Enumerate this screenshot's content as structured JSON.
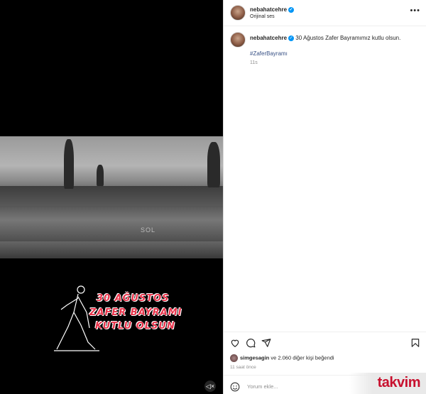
{
  "media": {
    "banner_lines": [
      "30 AĞUSTOS",
      "ZAFER BAYRAMI",
      "KUTLU OLSUN"
    ],
    "watermark": "SOL"
  },
  "header": {
    "username": "nebahatcehre",
    "subtitle": "Orijinal ses"
  },
  "caption": {
    "username": "nebahatcehre",
    "text": "30 Ağustos Zafer Bayramımız kutlu olsun.",
    "hashtag": "#ZaferBayramı",
    "time": "11s"
  },
  "likes": {
    "first_user": "simgesagin",
    "rest": "ve 2.060 diğer kişi beğendi"
  },
  "post_time": "11 saat önce",
  "comment": {
    "placeholder": "Yorum ekle..."
  },
  "site_logo": "takvim",
  "colors": {
    "verified": "#0095f6",
    "banner_red": "#e8334a",
    "hashtag": "#385185"
  }
}
